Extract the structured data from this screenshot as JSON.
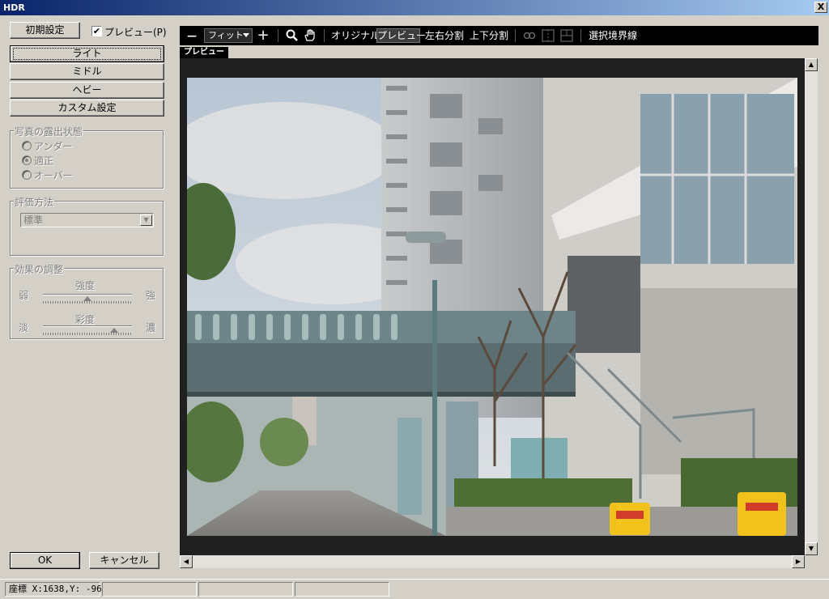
{
  "window": {
    "title": "HDR",
    "close_label": "X"
  },
  "left_panel": {
    "reset_button": "初期設定",
    "preview_checkbox": {
      "checked": "✔",
      "label": "プレビュー(P)"
    },
    "presets": [
      "ライト",
      "ミドル",
      "ヘビー",
      "カスタム設定"
    ],
    "exposure_group": {
      "title": "写真の露出状態",
      "options": [
        "アンダー",
        "適正",
        "オーバー"
      ],
      "selected": "適正"
    },
    "evaluation_group": {
      "title": "評価方法",
      "selected_value": "標準"
    },
    "effect_group": {
      "title": "効果の調整",
      "strength": {
        "label": "強度",
        "min_label": "弱",
        "max_label": "強",
        "level_percent": 50
      },
      "saturation": {
        "label": "彩度",
        "min_label": "淡",
        "max_label": "濃",
        "level_percent": 80
      }
    },
    "ok_button": "OK",
    "cancel_button": "キャンセル"
  },
  "toolbar": {
    "zoom_out": "—",
    "zoom_select": "フィット",
    "zoom_in": "+",
    "original": "オリジナル",
    "preview": "プレビュー",
    "split_lr": "左右分割",
    "split_tb": "上下分割",
    "selection_border": "選択境界線",
    "icons": [
      "minus-icon",
      "plus-icon",
      "magnifier-icon",
      "hand-icon",
      "link-icon",
      "split-vertical-icon",
      "split-horizontal-icon"
    ]
  },
  "tab": {
    "label": "プレビュー"
  },
  "scroll": {
    "up": "▲",
    "down": "▼",
    "left": "◀",
    "right": "▶"
  },
  "status": {
    "coordinates": "座標 X:1638,Y: -96"
  },
  "colors": {
    "sky": "#9fb3c8",
    "building": "#b9bcbf",
    "bridge": "#6d8588",
    "foliage": "#4c6b3a",
    "accent_yellow": "#f1c21b"
  }
}
